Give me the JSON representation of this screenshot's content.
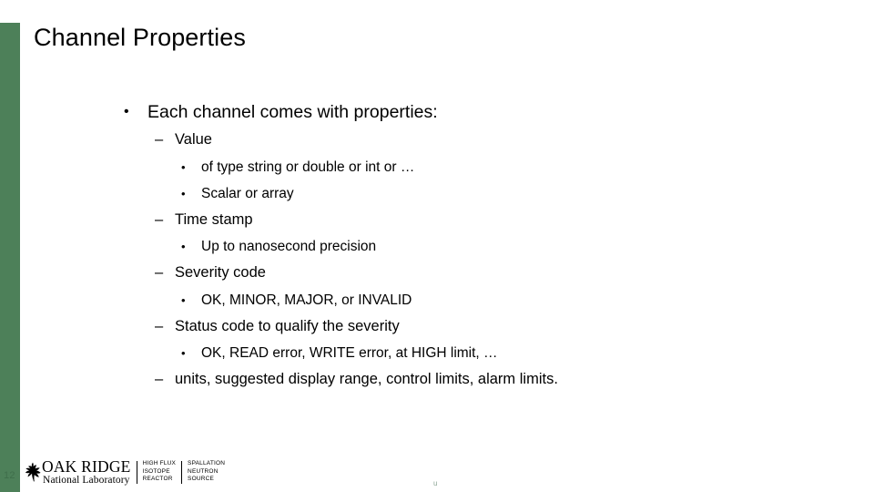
{
  "slide": {
    "title": "Channel Properties",
    "page_number": "12",
    "accent_color": "#4d8059",
    "background_color": "#ffffff",
    "footer_artifact": "u"
  },
  "content": {
    "lines": [
      {
        "level": 1,
        "marker": "•",
        "text": "Each channel comes with properties:"
      },
      {
        "level": 2,
        "marker": "–",
        "text": "Value"
      },
      {
        "level": 3,
        "marker": "•",
        "text": "of type string or double or int or …"
      },
      {
        "level": 3,
        "marker": "•",
        "text": "Scalar or array"
      },
      {
        "level": 2,
        "marker": "–",
        "text": "Time stamp"
      },
      {
        "level": 3,
        "marker": "•",
        "text": "Up to nanosecond precision"
      },
      {
        "level": 2,
        "marker": "–",
        "text": "Severity code"
      },
      {
        "level": 3,
        "marker": "•",
        "text": "OK, MINOR, MAJOR, or INVALID"
      },
      {
        "level": 2,
        "marker": "–",
        "text": "Status code to qualify the severity"
      },
      {
        "level": 3,
        "marker": "•",
        "text": "OK,  READ error, WRITE error, at HIGH limit, …"
      },
      {
        "level": 2,
        "marker": "–",
        "text": "units, suggested display range, control limits, alarm limits."
      }
    ]
  },
  "footer": {
    "logo": {
      "primary_line_1": "OAK RIDGE",
      "primary_line_2": "National Laboratory",
      "facility_1": "HIGH FLUX\nISOTOPE\nREACTOR",
      "facility_2": "SPALLATION\nNEUTRON\nSOURCE"
    }
  }
}
